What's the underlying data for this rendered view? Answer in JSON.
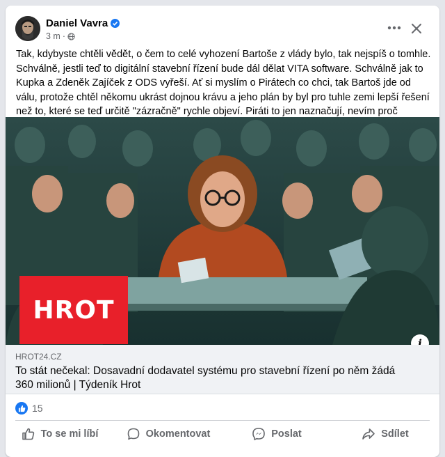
{
  "post": {
    "author": "Daniel Vavra",
    "time": "3 m",
    "separator": "·",
    "text": "Tak, kdybyste chtěli vědět, o čem to celé vyhození Bartoše z vlády bylo, tak nejspíš o tomhle. Schválně, jestli teď to digitální stavební řízení bude dál dělat VITA software. Schválně jak to Kupka a Zdeněk Zajíček z ODS vyřeší. Ať si myslím o Pirátech co chci, tak Bartoš jde od válu, protože chtěl někomu ukrást dojnou krávu a jeho plán by byl pro tuhle zemi lepší řešení než to, které se teď určitě \"zázračně\" rychle objeví. Piráti to jen naznačují, nevím proč neřeknou nic konkrétního."
  },
  "link": {
    "image_badge": "HROT",
    "domain": "HROT24.CZ",
    "title": "To stát nečekal: Dosavadní dodavatel systému pro stavební řízení po něm žádá 360 milionů | Týdeník Hrot",
    "info_icon": "i"
  },
  "reactions": {
    "count": "15"
  },
  "actions": [
    {
      "label": "To se mi líbí",
      "icon": "thumbs-up-icon"
    },
    {
      "label": "Okomentovat",
      "icon": "comment-icon"
    },
    {
      "label": "Poslat",
      "icon": "messenger-icon"
    },
    {
      "label": "Sdílet",
      "icon": "share-icon"
    }
  ],
  "colors": {
    "accent": "#1877f2",
    "badge": "#e8202a",
    "secondary_text": "#65676b"
  }
}
